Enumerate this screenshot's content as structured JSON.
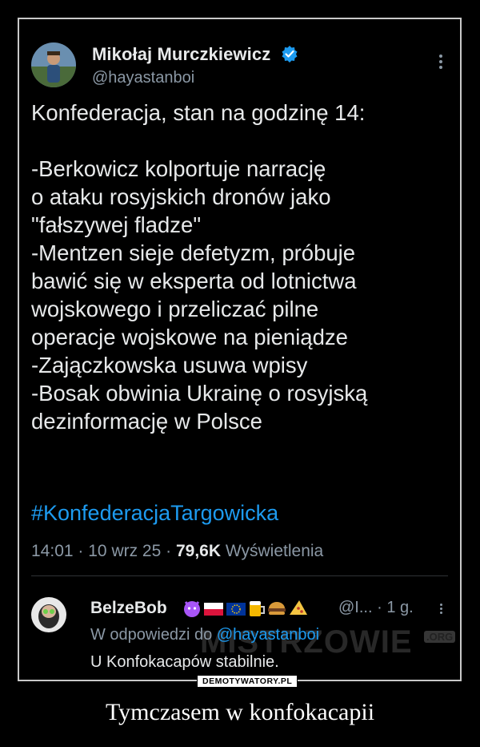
{
  "tweet": {
    "author_name": "Mikołaj Murczkiewicz",
    "author_handle": "@hayastanboi",
    "lines": [
      "Konfederacja, stan na godzinę 14:",
      "",
      "-Berkowicz kolportuje narrację",
      "o ataku rosyjskich dronów jako",
      "\"fałszywej fladze\"",
      "-Mentzen sieje defetyzm, próbuje",
      "bawić się w eksperta od lotnictwa",
      "wojskowego i przeliczać pilne",
      "operacje wojskowe na pieniądze",
      "-Zajączkowska usuwa wpisy",
      "-Bosak obwinia Ukrainę o rosyjską",
      "dezinformację w Polsce"
    ],
    "hashtag": "#KonfederacjaTargowicka",
    "time": "14:01",
    "date": "10 wrz 25",
    "views_count": "79,6K",
    "views_label": "Wyświetlenia",
    "separator": "·"
  },
  "reply": {
    "author_name": "BelzeBob",
    "author_handle": "@I...",
    "time_ago": "1 g.",
    "reply_prefix": "W odpowiedzi do",
    "reply_to": "@hayastanboi",
    "text": "U Konfokacapów stabilnie."
  },
  "watermark": {
    "text": "MISTRZOWIE",
    "org": ".ORG",
    "badge": "DEMOTYWATORY.PL"
  },
  "caption": "Tymczasem w konfokacapii",
  "colors": {
    "background": "#000000",
    "text": "#e7e9ea",
    "muted": "#8b98a5",
    "link": "#1d9bf0",
    "verified": "#1d9bf0"
  },
  "icons": [
    "verified-badge-icon",
    "more-options-icon",
    "devil-emoji-icon",
    "poland-flag-icon",
    "eu-flag-icon",
    "beer-emoji-icon",
    "burger-emoji-icon",
    "pizza-emoji-icon"
  ]
}
